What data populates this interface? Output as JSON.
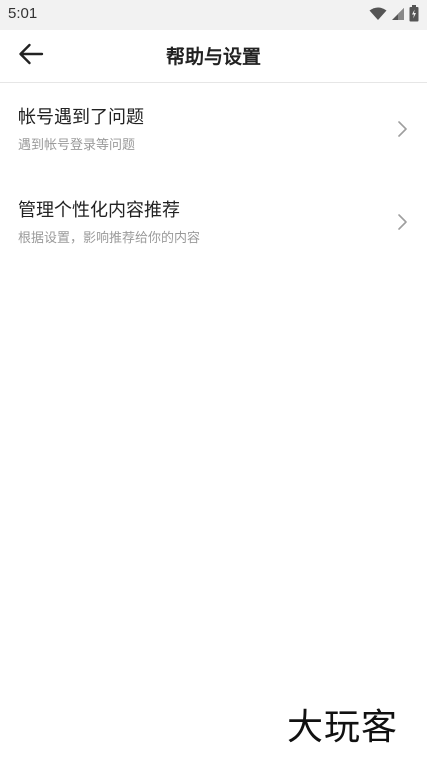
{
  "status_bar": {
    "time": "5:01",
    "icons": [
      "wifi-icon",
      "signal-icon",
      "battery-icon"
    ]
  },
  "header": {
    "back_icon": "back-arrow-icon",
    "title": "帮助与设置"
  },
  "list": {
    "items": [
      {
        "title": "帐号遇到了问题",
        "subtitle": "遇到帐号登录等问题",
        "icon": "chevron-right-icon"
      },
      {
        "title": "管理个性化内容推荐",
        "subtitle": "根据设置，影响推荐给你的内容",
        "icon": "chevron-right-icon"
      }
    ]
  },
  "watermark": {
    "text": "大玩客"
  },
  "colors": {
    "status_bar_bg": "#f2f2f2",
    "divider": "#e6e6e6",
    "title_text": "#222222",
    "subtitle_text": "#9a9a9a",
    "chevron": "#9e9e9e"
  }
}
